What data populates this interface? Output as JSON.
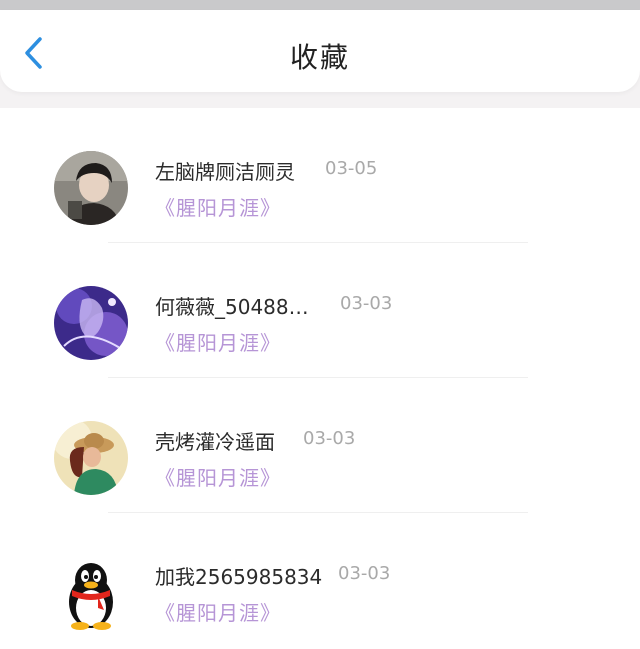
{
  "header": {
    "back_icon": "chevron-left-icon",
    "title": "收藏",
    "accent": "#2d8fe0"
  },
  "favorites": [
    {
      "name": "左脑牌厕洁厕灵",
      "date": "03-05",
      "book": "《腥阳月涯》",
      "avatar": "portrait-photo"
    },
    {
      "name": "何薇薇_50488…",
      "date": "03-03",
      "book": "《腥阳月涯》",
      "avatar": "purple-anime-art"
    },
    {
      "name": "壳烤灌冷遥面",
      "date": "03-03",
      "book": "《腥阳月涯》",
      "avatar": "girl-with-hat-photo"
    },
    {
      "name": "加我2565985834",
      "date": "03-03",
      "book": "《腥阳月涯》",
      "avatar": "qq-penguin-icon"
    }
  ],
  "colors": {
    "book_title": "#b695d6",
    "date": "#a9a9a9"
  }
}
